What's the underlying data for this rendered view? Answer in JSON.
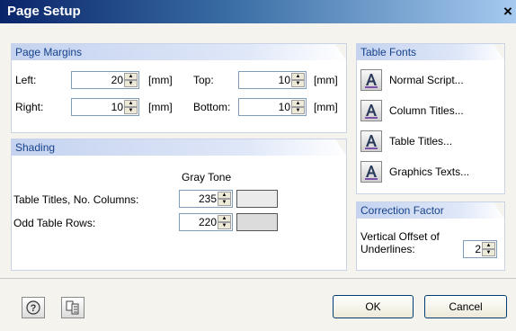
{
  "window": {
    "title": "Page Setup",
    "close_glyph": "×"
  },
  "page_margins": {
    "header": "Page Margins",
    "left_label": "Left:",
    "left_value": "20",
    "right_label": "Right:",
    "right_value": "10",
    "top_label": "Top:",
    "top_value": "10",
    "bottom_label": "Bottom:",
    "bottom_value": "10",
    "unit": "[mm]"
  },
  "shading": {
    "header": "Shading",
    "gray_tone_label": "Gray Tone",
    "table_titles_label": "Table Titles, No. Columns:",
    "table_titles_value": "235",
    "odd_rows_label": "Odd Table Rows:",
    "odd_rows_value": "220"
  },
  "table_fonts": {
    "header": "Table Fonts",
    "items": [
      "Normal Script...",
      "Column Titles...",
      "Table Titles...",
      "Graphics Texts..."
    ]
  },
  "correction_factor": {
    "header": "Correction Factor",
    "label_line1": "Vertical Offset of",
    "label_line2": "Underlines:",
    "value": "2"
  },
  "buttons": {
    "ok": "OK",
    "cancel": "Cancel"
  },
  "icons": {
    "help": "help-icon",
    "print_preview": "page-settings-icon",
    "font": "font-letter-icon"
  },
  "colors": {
    "header_text": "#15428b",
    "title_bar": "#0a246a"
  }
}
